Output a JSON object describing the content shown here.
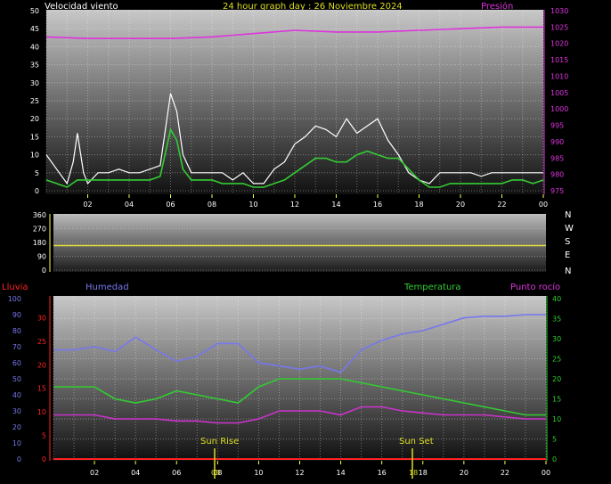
{
  "header": {
    "wind_label": "Velocidad viento",
    "title": "24 hour graph day : 26 Noviembre 2024",
    "pressure_label": "Presión"
  },
  "labels": {
    "rain": "Lluvia",
    "humidity": "Humedad",
    "temperature": "Temperatura",
    "dewpoint": "Punto rocío",
    "sunrise": "Sun Rise",
    "sunset": "Sun Set",
    "sunrise_time": "08",
    "sunset_time": "18"
  },
  "compass": [
    "N",
    "W",
    "S",
    "E",
    "N"
  ],
  "colors": {
    "wind_gust": "#ffffff",
    "wind_avg": "#33cc33",
    "pressure": "#dd33dd",
    "wind_dir": "#dddd44",
    "humidity": "#7777ee",
    "temperature": "#33cc33",
    "dewpoint": "#cc33cc",
    "rain": "#ff2222",
    "sun": "#dddd22",
    "hour_ticks": "#ffff44"
  },
  "chart_data": [
    {
      "type": "line",
      "name": "wind",
      "x_ticks": [
        "02",
        "04",
        "06",
        "08",
        "10",
        "12",
        "14",
        "16",
        "18",
        "20",
        "22",
        "00"
      ],
      "ylim_left": [
        0,
        50
      ],
      "y_ticks_left": [
        0,
        5,
        10,
        15,
        20,
        25,
        30,
        35,
        40,
        45,
        50
      ],
      "ylim_right": [
        975,
        1030
      ],
      "y_ticks_right": [
        975,
        980,
        985,
        990,
        995,
        1000,
        1005,
        1010,
        1015,
        1020,
        1025,
        1030
      ],
      "series": [
        {
          "name": "Velocidad viento",
          "role": "gust",
          "x": [
            0,
            0.5,
            1,
            1.3,
            1.5,
            1.8,
            2,
            2.5,
            3,
            3.5,
            4,
            4.5,
            5,
            5.5,
            6,
            6.3,
            6.6,
            7,
            7.5,
            8,
            8.5,
            9,
            9.5,
            10,
            10.5,
            11,
            11.5,
            12,
            12.5,
            13,
            13.5,
            14,
            14.5,
            15,
            15.5,
            16,
            16.5,
            17,
            17.5,
            18,
            18.5,
            19,
            19.5,
            20,
            20.5,
            21,
            21.5,
            22,
            22.5,
            23,
            23.5,
            24
          ],
          "y": [
            10,
            6,
            2,
            8,
            16,
            5,
            2,
            5,
            5,
            6,
            5,
            5,
            6,
            7,
            27,
            22,
            10,
            5,
            5,
            5,
            5,
            3,
            5,
            2,
            2,
            6,
            8,
            13,
            15,
            18,
            17,
            15,
            20,
            16,
            18,
            20,
            14,
            10,
            5,
            3,
            2,
            5,
            5,
            5,
            5,
            4,
            5,
            5,
            5,
            5,
            5,
            5
          ]
        },
        {
          "name": "Velocidad viento",
          "role": "average",
          "x": [
            0,
            0.5,
            1,
            1.5,
            2,
            2.5,
            3,
            3.5,
            4,
            4.5,
            5,
            5.5,
            6,
            6.3,
            6.6,
            7,
            7.5,
            8,
            8.5,
            9,
            9.5,
            10,
            10.5,
            11,
            11.5,
            12,
            12.5,
            13,
            13.5,
            14,
            14.5,
            15,
            15.5,
            16,
            16.5,
            17,
            17.5,
            18,
            18.5,
            19,
            19.5,
            20,
            20.5,
            21,
            21.5,
            22,
            22.5,
            23,
            23.5,
            24
          ],
          "y": [
            3,
            2,
            1,
            3,
            3,
            3,
            3,
            3,
            3,
            3,
            3,
            4,
            17,
            14,
            6,
            3,
            3,
            3,
            2,
            2,
            2,
            1,
            1,
            2,
            3,
            5,
            7,
            9,
            9,
            8,
            8,
            10,
            11,
            10,
            9,
            9,
            6,
            3,
            1,
            1,
            2,
            2,
            2,
            2,
            2,
            2,
            3,
            3,
            2,
            3
          ]
        },
        {
          "name": "Presión",
          "role": "pressure",
          "axis": "right",
          "x": [
            0,
            2,
            4,
            6,
            8,
            10,
            12,
            14,
            16,
            18,
            20,
            22,
            24
          ],
          "y": [
            1022,
            1021.5,
            1021.5,
            1021.5,
            1022,
            1023,
            1024,
            1023.5,
            1023.5,
            1024,
            1024.5,
            1025,
            1025
          ]
        }
      ]
    },
    {
      "type": "line",
      "name": "wind_direction",
      "ylim": [
        0,
        360
      ],
      "y_ticks": [
        0,
        90,
        180,
        270,
        360
      ],
      "series": [
        {
          "name": "wind direction",
          "x": [
            0,
            24
          ],
          "y": [
            160,
            160
          ]
        }
      ]
    },
    {
      "type": "line",
      "name": "temp_humidity",
      "x_ticks": [
        "02",
        "04",
        "06",
        "08",
        "10",
        "12",
        "14",
        "16",
        "18",
        "20",
        "22",
        "00"
      ],
      "ylim_humidity": [
        0,
        100
      ],
      "y_ticks_humidity": [
        0,
        10,
        20,
        30,
        40,
        50,
        60,
        70,
        80,
        90,
        100
      ],
      "ylim_rain": [
        0,
        35
      ],
      "y_ticks_rain": [
        0,
        5,
        10,
        15,
        20,
        25,
        30
      ],
      "ylim_temp": [
        0,
        40
      ],
      "y_ticks_temp": [
        0,
        5,
        10,
        15,
        20,
        25,
        30,
        35,
        40
      ],
      "series": [
        {
          "name": "Humedad",
          "axis": "humidity",
          "x": [
            0,
            1,
            2,
            3,
            4,
            5,
            6,
            7,
            8,
            9,
            10,
            11,
            12,
            13,
            14,
            15,
            16,
            17,
            18,
            19,
            20,
            21,
            22,
            23,
            24
          ],
          "y": [
            68,
            68,
            70,
            67,
            76,
            68,
            61,
            64,
            72,
            72,
            60,
            58,
            56,
            58,
            54,
            68,
            74,
            78,
            80,
            84,
            88,
            89,
            89,
            90,
            90
          ]
        },
        {
          "name": "Temperatura",
          "axis": "temp",
          "x": [
            0,
            1,
            2,
            3,
            4,
            5,
            6,
            7,
            8,
            9,
            10,
            11,
            12,
            13,
            14,
            15,
            16,
            17,
            18,
            19,
            20,
            21,
            22,
            23,
            24
          ],
          "y": [
            18,
            18,
            18,
            15,
            14,
            15,
            17,
            16,
            15,
            14,
            18,
            20,
            20,
            20,
            20,
            19,
            18,
            17,
            16,
            15,
            14,
            13,
            12,
            11,
            11
          ]
        },
        {
          "name": "Punto rocío",
          "axis": "temp",
          "x": [
            0,
            1,
            2,
            3,
            4,
            5,
            6,
            7,
            8,
            9,
            10,
            11,
            12,
            13,
            14,
            15,
            16,
            17,
            18,
            19,
            20,
            21,
            22,
            23,
            24
          ],
          "y": [
            11,
            11,
            11,
            10,
            10,
            10,
            9.5,
            9.5,
            9,
            9,
            10,
            12,
            12,
            12,
            11,
            13,
            13,
            12,
            11.5,
            11,
            11,
            11,
            10.5,
            10,
            10
          ]
        },
        {
          "name": "Lluvia",
          "axis": "rain",
          "x": [
            0,
            24
          ],
          "y": [
            0,
            0
          ]
        }
      ]
    }
  ]
}
